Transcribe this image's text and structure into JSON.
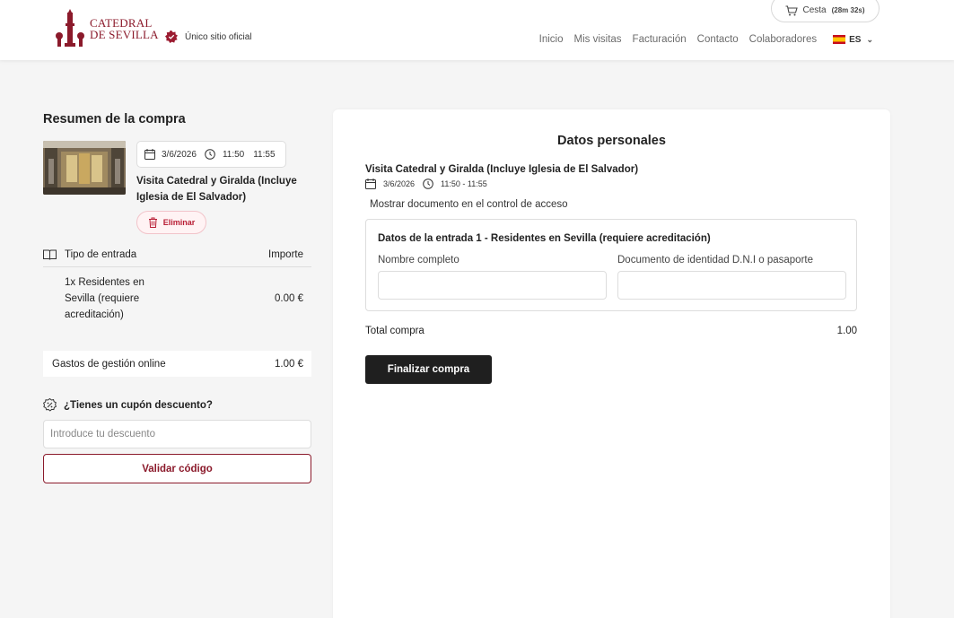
{
  "header": {
    "logo_line1": "CATEDRAL",
    "logo_line2": "DE SEVILLA",
    "official_label": "Único sitio oficial",
    "cart_label": "Cesta",
    "cart_timer": "(28m 32s)",
    "nav": [
      "Inicio",
      "Mis visitas",
      "Facturación",
      "Contacto",
      "Colaboradores"
    ],
    "lang": "ES"
  },
  "summary": {
    "title": "Resumen de la compra",
    "date": "3/6/2026",
    "time_start": "11:50",
    "time_end": "11:55",
    "visit_name": "Visita Catedral y Giralda (Incluye Iglesia de El Salvador)",
    "delete_label": "Eliminar",
    "col_type": "Tipo de entrada",
    "col_amount": "Importe",
    "ticket_desc": "1x Residentes en Sevilla (requiere acreditación)",
    "ticket_price": "0.00 €",
    "fees_label": "Gastos de gestión online",
    "fees_value": "1.00 €",
    "coupon_question": "¿Tienes un cupón descuento?",
    "coupon_placeholder": "Introduce tu descuento",
    "validate_label": "Validar código"
  },
  "personal": {
    "title": "Datos personales",
    "visit_name": "Visita Catedral y Giralda (Incluye Iglesia de El Salvador)",
    "date": "3/6/2026",
    "time": "11:50 - 11:55",
    "note": "Mostrar documento en el control de acceso",
    "entry_title": "Datos de la entrada 1 - Residentes en Sevilla (requiere acreditación)",
    "name_label": "Nombre completo",
    "name_value": "",
    "doc_label": "Documento de identidad D.N.I o pasaporte",
    "doc_value": "",
    "total_label": "Total compra",
    "total_value": "1.00",
    "finish_label": "Finalizar compra"
  },
  "colors": {
    "brand": "#8b1a2b",
    "delete": "#b81d34",
    "dark_button": "#1f1f1f",
    "background": "#f5f5f5"
  }
}
